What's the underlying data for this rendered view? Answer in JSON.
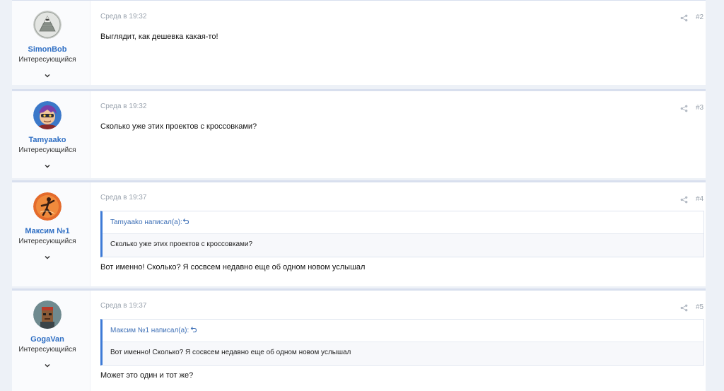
{
  "posts": [
    {
      "author": "SimonBob",
      "user_title": "Интересующийся",
      "date": "Среда в 19:32",
      "number": "#2",
      "message": "Выглядит, как дешевка какая-то!",
      "avatar_icon": "illuminati-pyramid-avatar"
    },
    {
      "author": "Tamyaako",
      "user_title": "Интересующийся",
      "date": "Среда в 19:32",
      "number": "#3",
      "message": "Сколько уже этих проектов с кроссовками?",
      "avatar_icon": "cartoon-hero-avatar"
    },
    {
      "author": "Максим №1",
      "user_title": "Интересующийся",
      "date": "Среда в 19:37",
      "number": "#4",
      "quote_author": "Tamyaako написал(а):",
      "quote_text": "Сколько уже этих проектов с кроссовками?",
      "message": "Вот именно! Сколько? Я сосвсем недавно еще об одном новом услышал",
      "avatar_icon": "orange-dancer-avatar"
    },
    {
      "author": "GogaVan",
      "user_title": "Интересующийся",
      "date": "Среда в 19:37",
      "number": "#5",
      "quote_author": "Максим №1 написал(а):",
      "quote_text": "Вот именно! Сколько? Я сосвсем недавно еще об одном новом услышал",
      "message": "Может это один и тот же?",
      "avatar_icon": "pixel-punk-avatar"
    }
  ],
  "colors": {
    "link": "#2f6fc4",
    "quote_border": "#3d7ad6",
    "meta": "#9aa3ae",
    "background": "#edf1f7"
  }
}
